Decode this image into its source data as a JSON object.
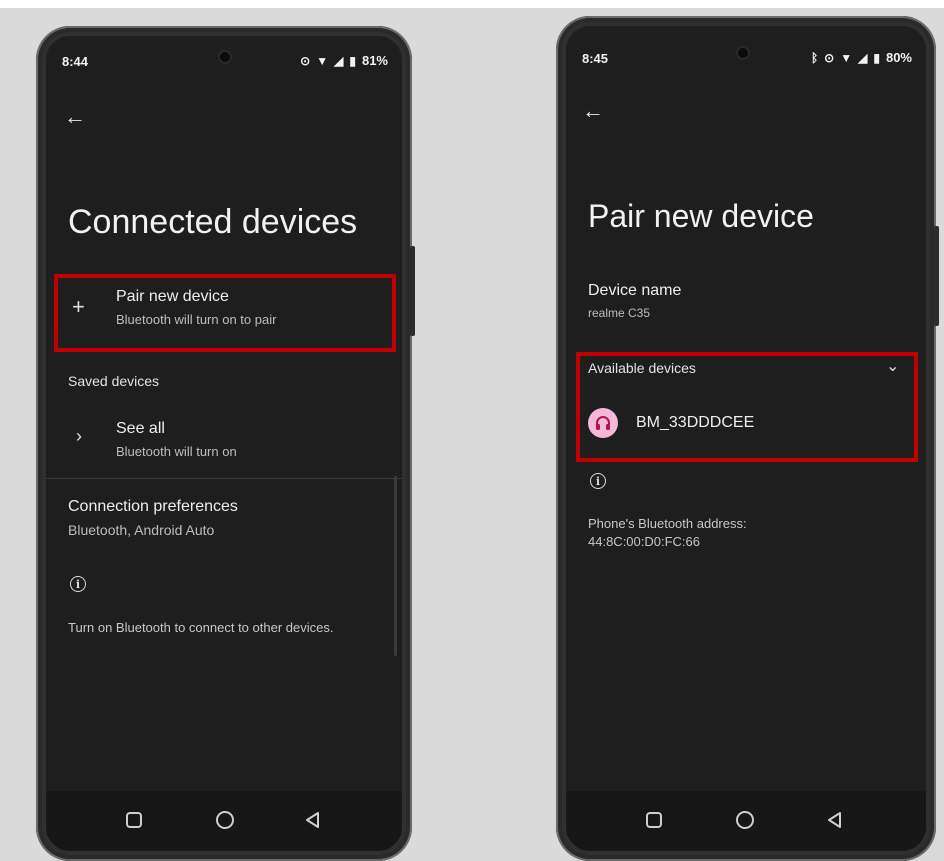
{
  "left": {
    "status": {
      "time": "8:44",
      "battery": "81%"
    },
    "title": "Connected devices",
    "pair": {
      "title": "Pair new device",
      "subtitle": "Bluetooth will turn on to pair"
    },
    "saved_header": "Saved devices",
    "see_all": {
      "title": "See all",
      "subtitle": "Bluetooth will turn on"
    },
    "prefs": {
      "title": "Connection preferences",
      "subtitle": "Bluetooth, Android Auto"
    },
    "info_text": "Turn on Bluetooth to connect to other devices."
  },
  "right": {
    "status": {
      "time": "8:45",
      "battery": "80%"
    },
    "title": "Pair new device",
    "device_name": {
      "label": "Device name",
      "value": "realme C35"
    },
    "available_header": "Available devices",
    "device": "BM_33DDDCEE",
    "address": {
      "label": "Phone's Bluetooth address:",
      "value": "44:8C:00:D0:FC:66"
    }
  },
  "icons": {
    "back": "back-arrow-icon",
    "plus": "plus-icon",
    "chevron": "chevron-right-icon",
    "info": "info-icon",
    "headset": "headset-icon"
  },
  "colors": {
    "highlight": "#c00000",
    "screen": "#1e1e1e",
    "headset_bg": "#f5b8d8"
  }
}
